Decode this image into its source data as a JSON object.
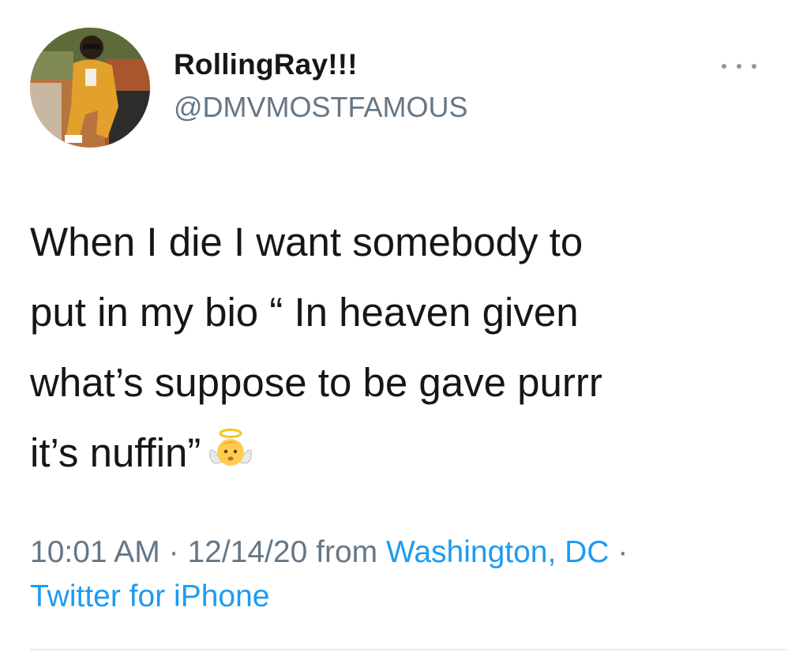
{
  "tweet": {
    "display_name": "RollingRay!!!",
    "handle": "@DMVMOSTFAMOUS",
    "text": "When I die I want somebody to\nput in my bio “ In heaven given\nwhat’s suppose to be gave purrr\nit’s nuffin”",
    "emoji": "baby-angel-icon",
    "time": "10:01 AM",
    "date": "12/14/20",
    "separator": "·",
    "from_label": "from",
    "location": "Washington, DC",
    "source": "Twitter for iPhone"
  },
  "icons": {
    "more": "more-horizontal-icon",
    "avatar": "avatar"
  },
  "colors": {
    "text": "#14171a",
    "secondary": "#657786",
    "link": "#1d9bf0",
    "divider": "#e6ecf0"
  }
}
